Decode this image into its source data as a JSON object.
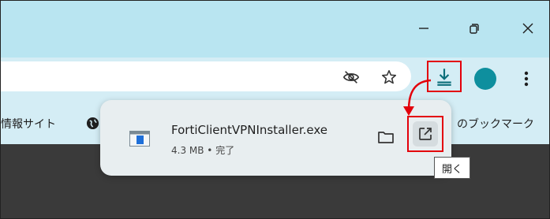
{
  "window": {
    "controls": {
      "minimize_icon": "minimize-icon",
      "restore_icon": "restore-icon",
      "close_icon": "close-icon"
    },
    "colors": {
      "titlebar": "#b9e5f1",
      "toolbar": "#d4edf5",
      "highlight": "#e3000b",
      "avatar": "#0e8f9e"
    }
  },
  "toolbar": {
    "icons": [
      "eye-off-icon",
      "star-icon",
      "download-icon",
      "avatar",
      "more-vert-icon"
    ]
  },
  "bookmarks": {
    "left_text": "情報サイト",
    "right_text": "のブックマーク"
  },
  "download_bubble": {
    "file_name": "FortiClientVPNInstaller.exe",
    "file_status": "4.3 MB • 完了",
    "open_tooltip": "開く"
  }
}
